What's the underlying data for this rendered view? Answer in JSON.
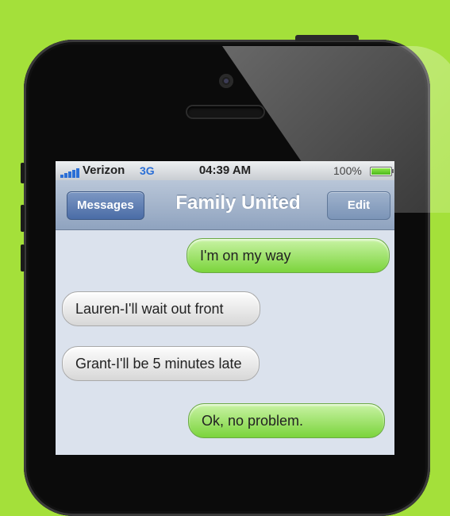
{
  "status_bar": {
    "carrier": "Verizon",
    "network": "3G",
    "time": "04:39 AM",
    "battery_percent": "100%",
    "battery_level": 1.0
  },
  "nav": {
    "back_label": "Messages",
    "title": "Family United",
    "edit_label": "Edit"
  },
  "messages": [
    {
      "direction": "outgoing",
      "text": "I'm on my way"
    },
    {
      "direction": "incoming",
      "text": "Lauren-I'll wait out front"
    },
    {
      "direction": "incoming",
      "text": "Grant-I'll be 5 minutes late"
    },
    {
      "direction": "outgoing",
      "text": "Ok, no problem."
    }
  ],
  "colors": {
    "background": "#a4e03a",
    "outgoing_bubble": "#7bd43c",
    "incoming_bubble": "#e6e6e6",
    "nav_bar": "#8fa3bf"
  }
}
